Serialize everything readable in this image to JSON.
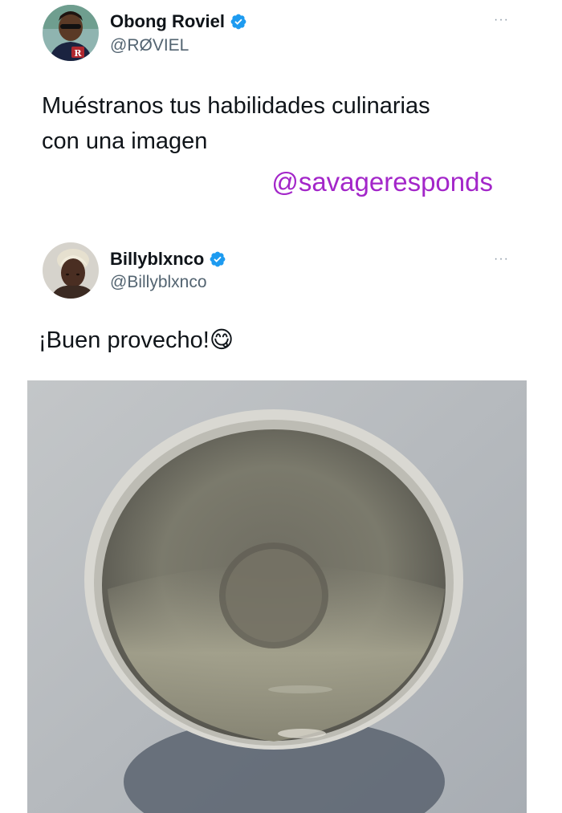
{
  "tweet1": {
    "display_name": "Obong Roviel",
    "handle": "@RØVIEL",
    "text_line1": "Muéstranos tus habilidades culinarias",
    "text_line2": "con una imagen",
    "more_label": "···",
    "verified": true,
    "avatar_icon": "user-avatar-sunglasses"
  },
  "watermark": "@savageresponds",
  "tweet2": {
    "display_name": "Billyblxnco",
    "handle": "@Billyblxnco",
    "text": "¡Buen provecho!",
    "emoji": "😋",
    "more_label": "···",
    "verified": true,
    "avatar_icon": "user-avatar-blonde"
  },
  "photo": {
    "subject": "empty-bowl-photo"
  },
  "colors": {
    "verified_blue": "#1d9bf0",
    "watermark_purple": "#a326c9",
    "handle_gray": "#536471"
  }
}
